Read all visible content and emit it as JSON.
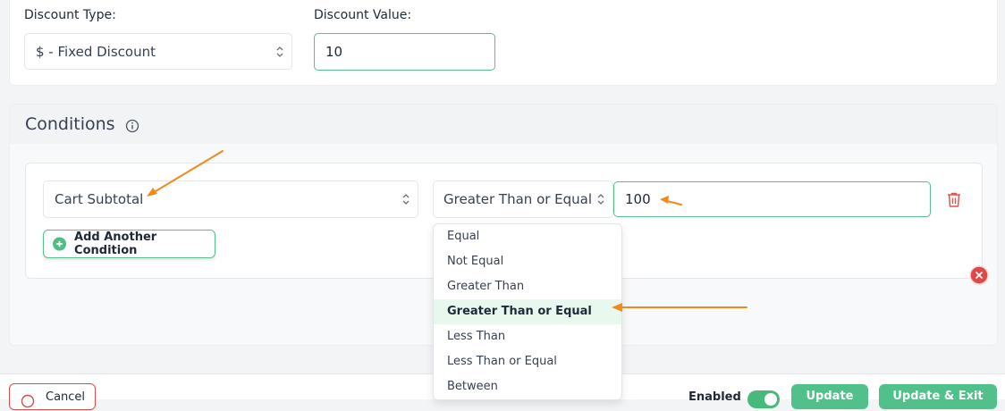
{
  "discount": {
    "type_label": "Discount Type:",
    "type_value": "$ - Fixed Discount",
    "value_label": "Discount Value:",
    "value": "10"
  },
  "conditions": {
    "title": "Conditions",
    "field_value": "Cart Subtotal",
    "operator_value": "Greater Than or Equal",
    "amount_value": "100",
    "add_button_label": "Add Another Condition",
    "operator_options": [
      "Equal",
      "Not Equal",
      "Greater Than",
      "Greater Than or Equal",
      "Less Than",
      "Less Than or Equal",
      "Between"
    ],
    "selected_operator": "Greater Than or Equal"
  },
  "footer": {
    "cancel_label": "Cancel",
    "enabled_label": "Enabled",
    "update_label": "Update",
    "update_exit_label": "Update & Exit"
  },
  "colors": {
    "accent": "#52c08a",
    "danger": "#dc4a4a",
    "annotation": "#f08a1c"
  }
}
